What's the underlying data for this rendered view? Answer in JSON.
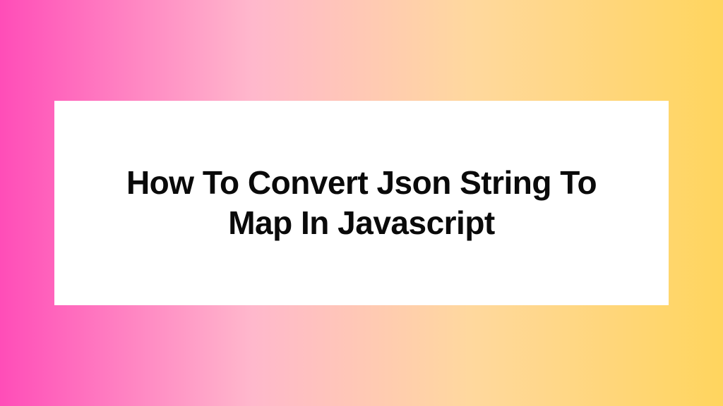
{
  "card": {
    "title": "How To Convert Json String To Map In Javascript"
  }
}
